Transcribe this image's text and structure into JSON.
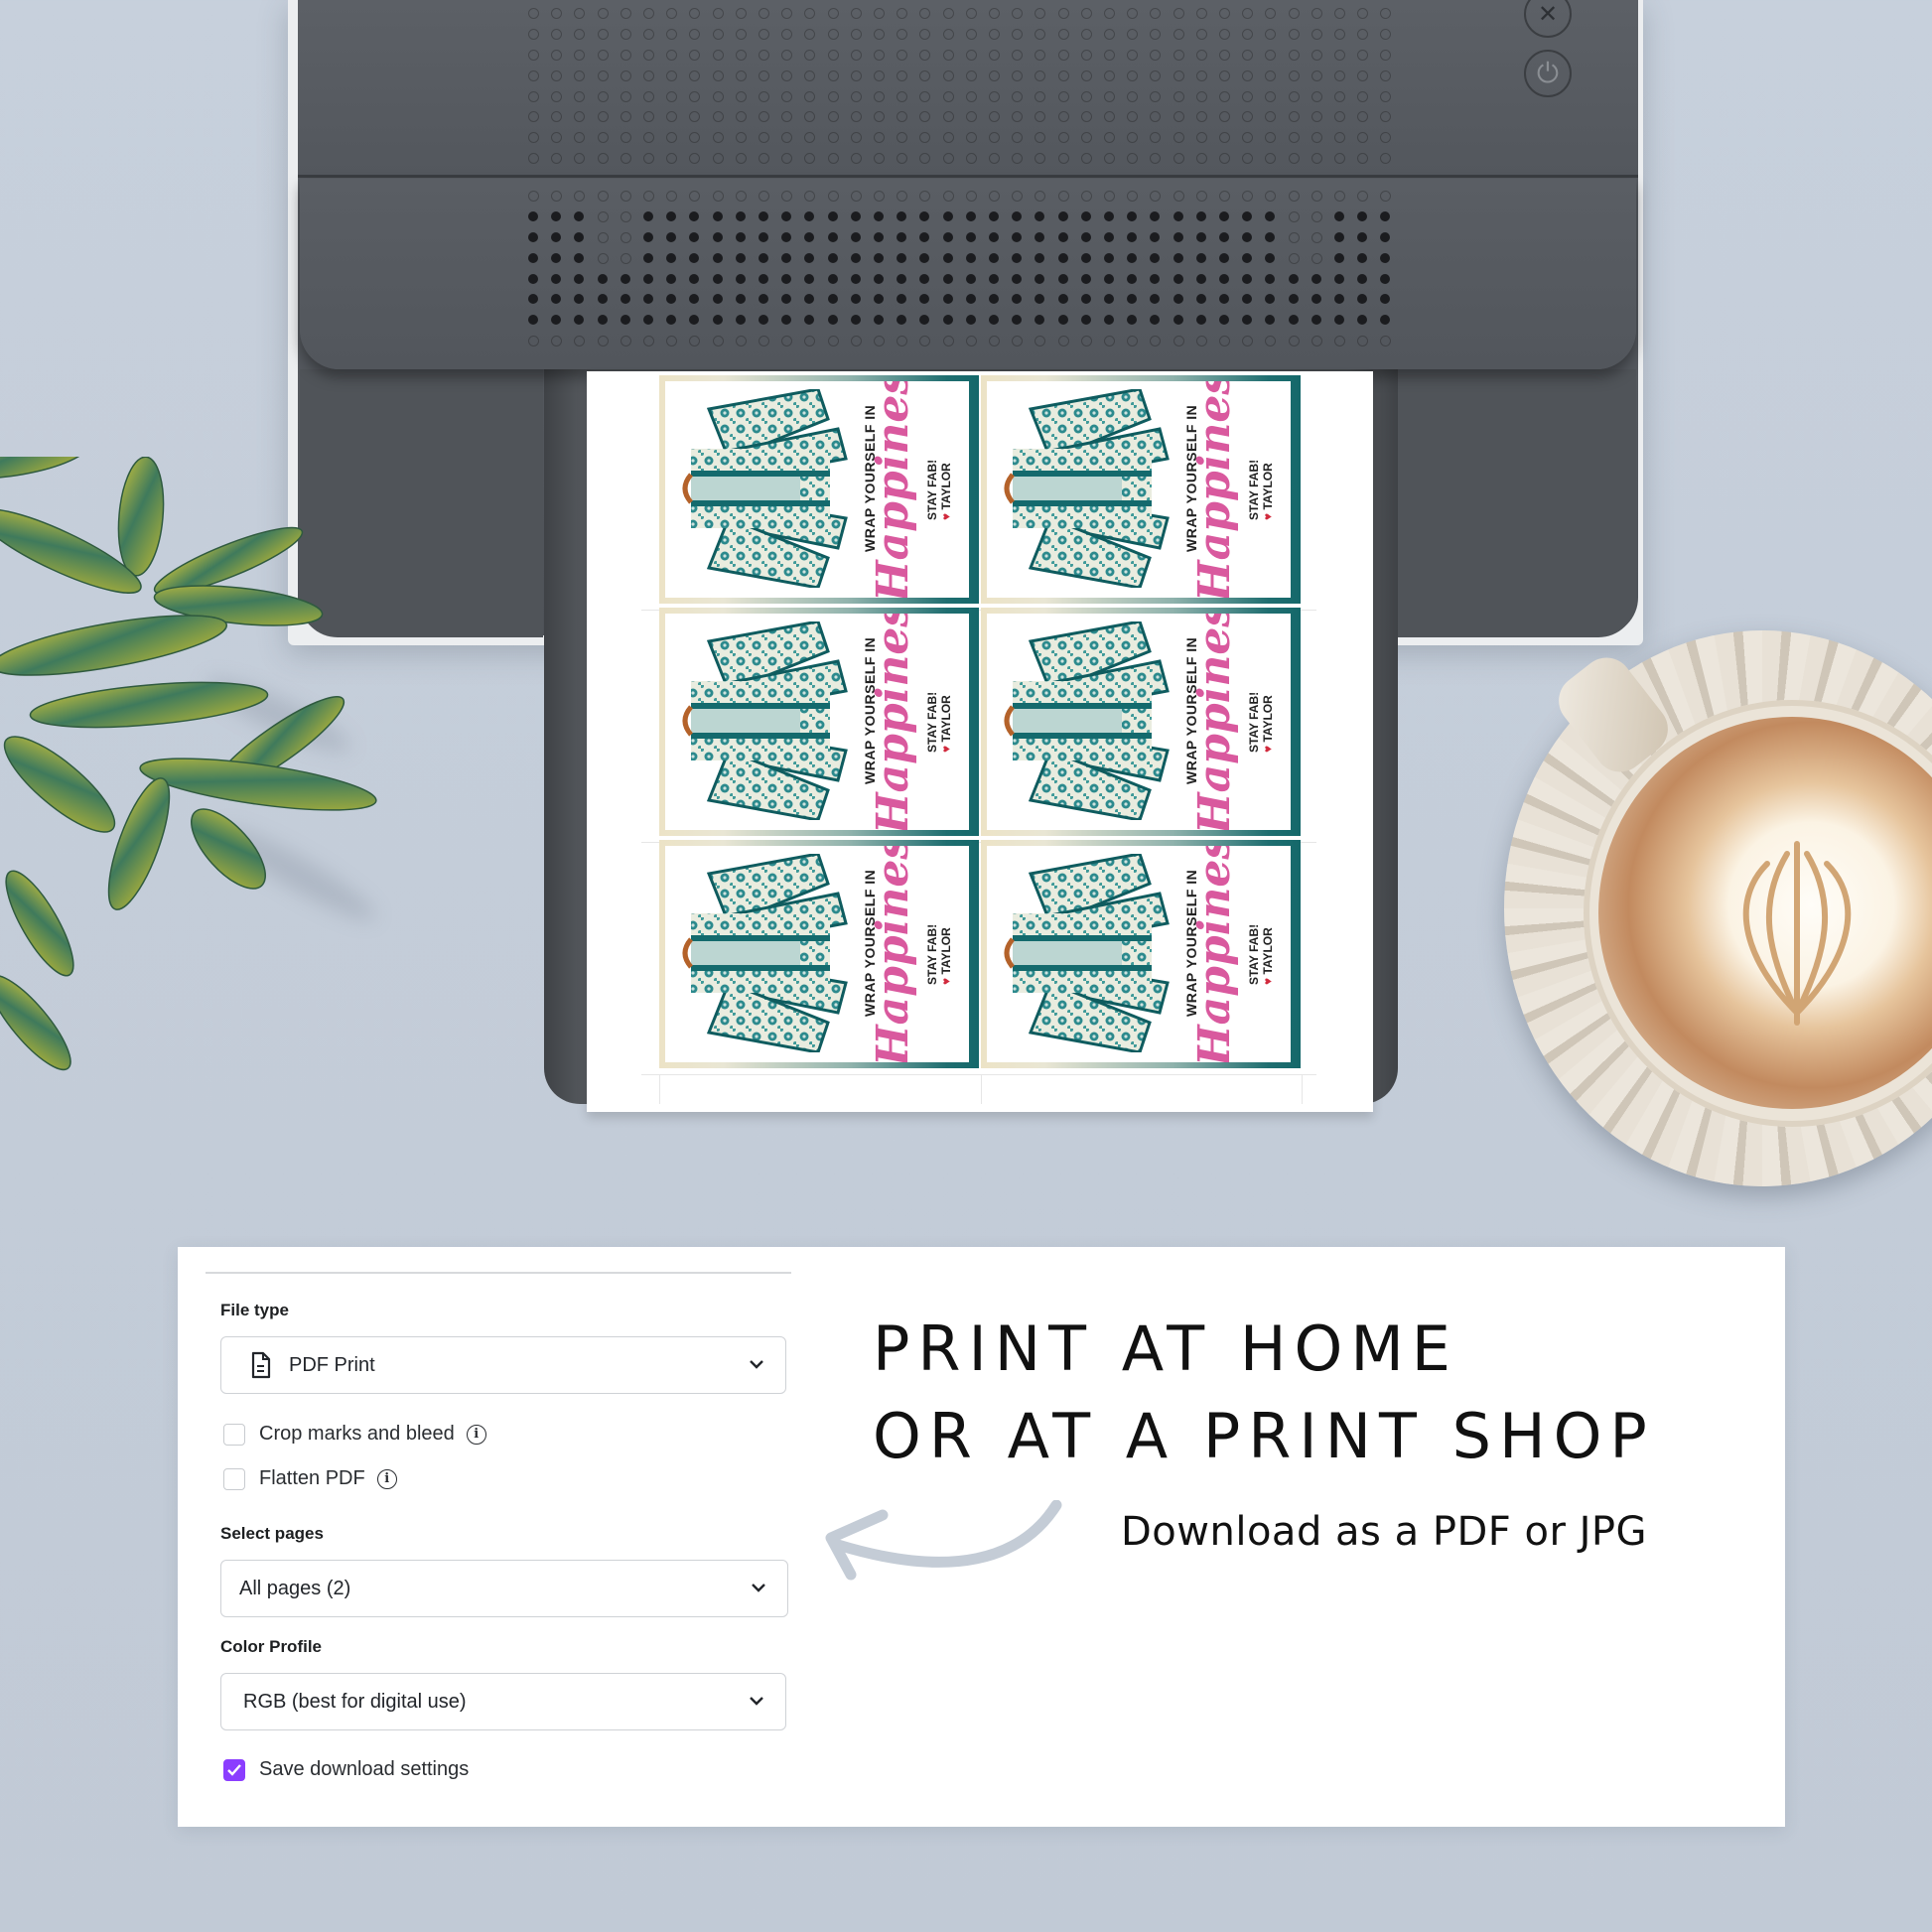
{
  "scene": {
    "background_color": "#c7d0dc",
    "printer": {
      "buttons": [
        {
          "name": "cancel",
          "icon": "close-icon",
          "glyph": "✕"
        },
        {
          "name": "power",
          "icon": "power-icon",
          "glyph": "⏻"
        }
      ]
    },
    "printed_sheet": {
      "card_count": 6,
      "card": {
        "headline": "WRAP YOURSELF IN",
        "script_word": "Happiness",
        "signoff_line1": "STAY FAB!",
        "signoff_heart": "♥",
        "signoff_name": "TAYLOR"
      },
      "colors": {
        "accent_pink": "#d9599e",
        "frame_teal": "#14686a",
        "heart_red": "#d12a3d"
      }
    }
  },
  "download_panel": {
    "file_type": {
      "label": "File type",
      "value": "PDF Print",
      "icon": "document-icon"
    },
    "options": [
      {
        "label": "Crop marks and bleed",
        "checked": false,
        "has_info": true
      },
      {
        "label": "Flatten PDF",
        "checked": false,
        "has_info": true
      }
    ],
    "select_pages": {
      "label": "Select pages",
      "value": "All pages (2)"
    },
    "color_profile": {
      "label": "Color Profile",
      "value": "RGB (best for digital use)"
    },
    "save_settings": {
      "label": "Save download settings",
      "checked": true,
      "check_color": "#8b3dff"
    },
    "info_glyph": "i"
  },
  "promo": {
    "headline_line1": "PRINT AT HOME",
    "headline_line2": "OR AT A PRINT SHOP",
    "subline": "Download as a PDF or JPG",
    "arrow_color": "#c4ccd6"
  }
}
